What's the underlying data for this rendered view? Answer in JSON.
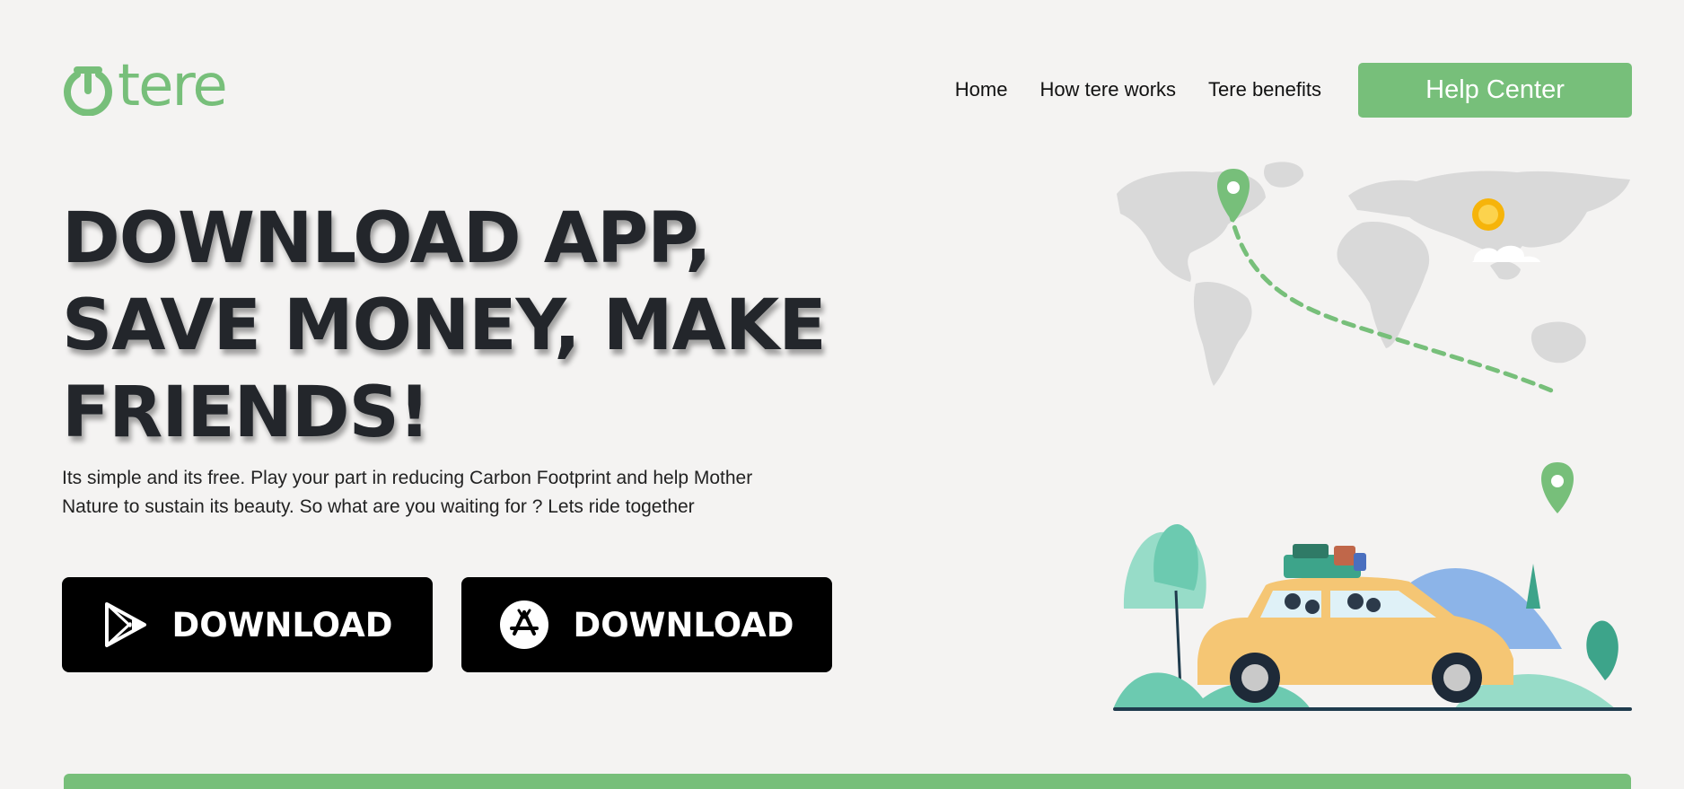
{
  "brand": {
    "name": "tere",
    "color": "#77bf7a"
  },
  "nav": {
    "items": [
      "Home",
      "How tere works",
      "Tere benefits"
    ],
    "help_button": "Help Center"
  },
  "hero": {
    "title_lines": [
      "DOWNLOAD APP,",
      "SAVE MONEY, MAKE",
      "FRIENDS!"
    ],
    "description_lines": [
      "Its simple and its free. Play your part in reducing Carbon Footprint and help Mother",
      "Nature to sustain its beauty. So what are you waiting for ? Lets ride together"
    ]
  },
  "downloads": [
    {
      "label": "DOWNLOAD",
      "icon": "google-play-icon"
    },
    {
      "label": "DOWNLOAD",
      "icon": "app-store-icon"
    }
  ],
  "colors": {
    "accent": "#77bf7a",
    "background": "#f4f3f2",
    "button": "#000000"
  }
}
